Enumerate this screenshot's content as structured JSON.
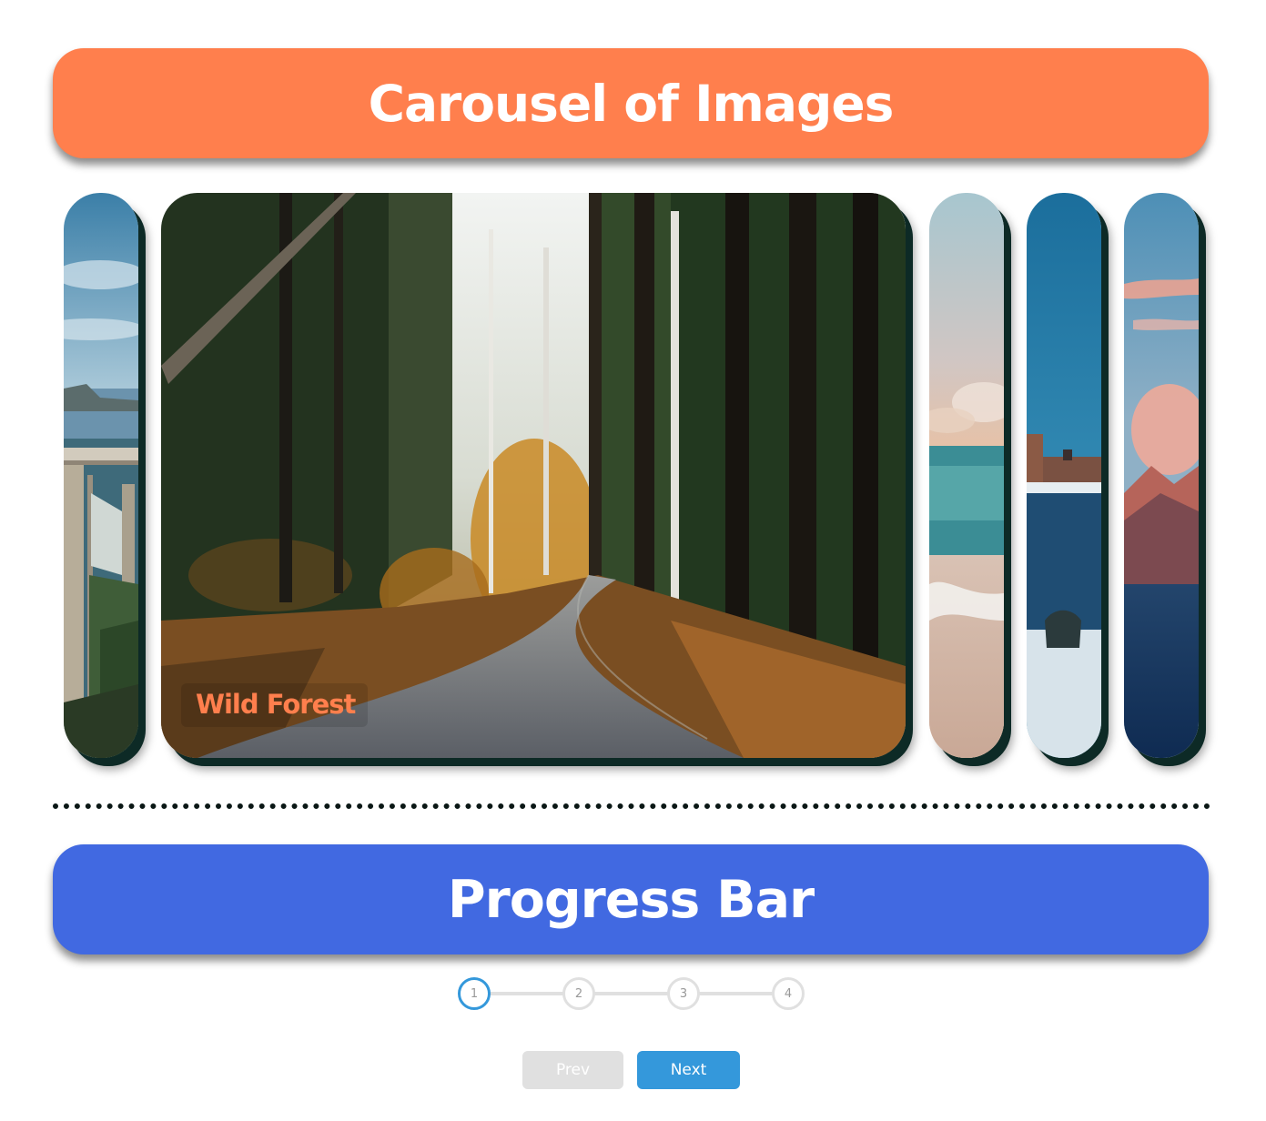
{
  "carousel": {
    "title": "Carousel of Images",
    "active_index": 1,
    "panels": [
      {
        "name": "bridge-coast-image"
      },
      {
        "name": "forest-road-image",
        "caption": "Wild Forest"
      },
      {
        "name": "beach-waves-image"
      },
      {
        "name": "city-harbor-image"
      },
      {
        "name": "mountains-sunset-image"
      }
    ]
  },
  "progress": {
    "title": "Progress Bar",
    "current_step": 1,
    "steps": [
      "1",
      "2",
      "3",
      "4"
    ],
    "prev_label": "Prev",
    "next_label": "Next",
    "prev_disabled": true
  },
  "colors": {
    "carousel_banner": "#ff7f4d",
    "progress_banner": "#4169e1",
    "accent": "#3498db",
    "inactive": "#e0e0e0"
  }
}
